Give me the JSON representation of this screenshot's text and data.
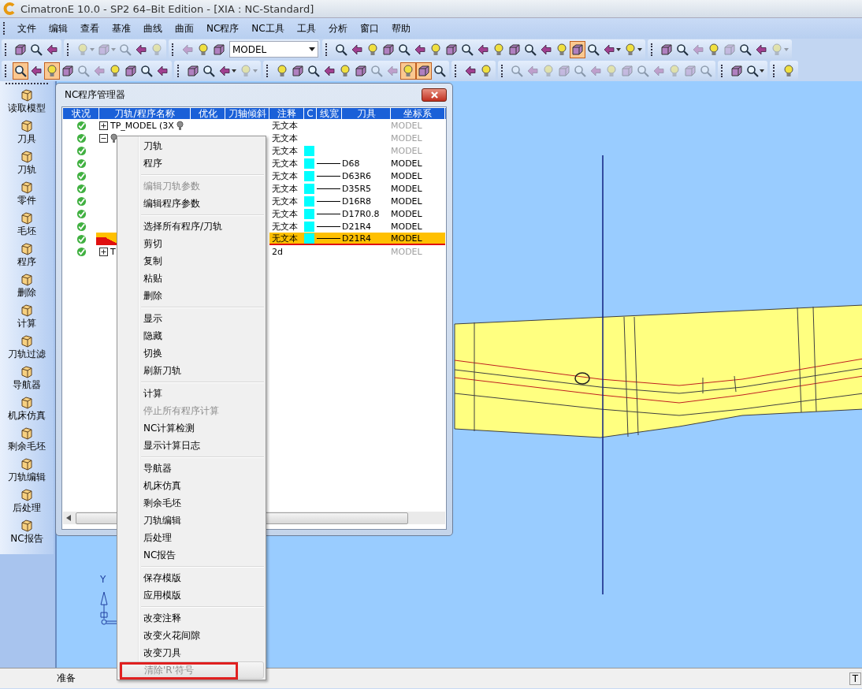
{
  "window": {
    "title": "CimatronE 10.0 - SP2 64–Bit Edition - [XIA : NC-Standard]"
  },
  "menu_bar": [
    "文件",
    "编辑",
    "查看",
    "基准",
    "曲线",
    "曲面",
    "NC程序",
    "NC工具",
    "工具",
    "分析",
    "窗口",
    "帮助"
  ],
  "toolbars": [
    {
      "groups": [
        {
          "buttons": [
            {
              "pressed": false,
              "disabled": false,
              "dropdown": false
            },
            {
              "pressed": false,
              "disabled": false,
              "dropdown": false
            },
            {
              "pressed": false,
              "disabled": false,
              "dropdown": false
            }
          ]
        },
        {
          "buttons": [
            {
              "pressed": false,
              "disabled": true,
              "dropdown": true
            },
            {
              "pressed": false,
              "disabled": true,
              "dropdown": true
            },
            {
              "pressed": false,
              "disabled": true,
              "dropdown": false
            },
            {
              "pressed": false,
              "disabled": false,
              "dropdown": false
            },
            {
              "pressed": false,
              "disabled": true,
              "dropdown": false
            }
          ]
        },
        {
          "buttons": [
            {
              "pressed": false,
              "disabled": true,
              "dropdown": false
            },
            {
              "pressed": false,
              "disabled": false,
              "dropdown": false
            },
            {
              "pressed": false,
              "disabled": false,
              "dropdown": false
            }
          ],
          "combo": {
            "value": "MODEL"
          }
        },
        {
          "buttons": [
            {
              "pressed": false,
              "disabled": false,
              "dropdown": false
            },
            {
              "pressed": false,
              "disabled": false,
              "dropdown": false
            },
            {
              "pressed": false,
              "disabled": false,
              "dropdown": false
            },
            {
              "pressed": false,
              "disabled": false,
              "dropdown": false
            },
            {
              "pressed": false,
              "disabled": false,
              "dropdown": false
            },
            {
              "pressed": false,
              "disabled": false,
              "dropdown": false
            },
            {
              "pressed": false,
              "disabled": false,
              "dropdown": false
            },
            {
              "pressed": false,
              "disabled": false,
              "dropdown": false
            },
            {
              "pressed": false,
              "disabled": false,
              "dropdown": false
            },
            {
              "pressed": false,
              "disabled": false,
              "dropdown": false
            },
            {
              "pressed": false,
              "disabled": false,
              "dropdown": false
            },
            {
              "pressed": false,
              "disabled": false,
              "dropdown": false
            },
            {
              "pressed": false,
              "disabled": false,
              "dropdown": false
            },
            {
              "pressed": false,
              "disabled": false,
              "dropdown": false
            },
            {
              "pressed": false,
              "disabled": false,
              "dropdown": false
            },
            {
              "pressed": true,
              "disabled": false,
              "dropdown": false
            },
            {
              "pressed": false,
              "disabled": false,
              "dropdown": false
            },
            {
              "pressed": false,
              "disabled": false,
              "dropdown": true
            },
            {
              "pressed": false,
              "disabled": false,
              "dropdown": true
            }
          ]
        },
        {
          "buttons": [
            {
              "pressed": false,
              "disabled": false,
              "dropdown": false
            },
            {
              "pressed": false,
              "disabled": false,
              "dropdown": false
            },
            {
              "pressed": false,
              "disabled": true,
              "dropdown": false
            },
            {
              "pressed": false,
              "disabled": false,
              "dropdown": false
            },
            {
              "pressed": false,
              "disabled": true,
              "dropdown": false
            },
            {
              "pressed": false,
              "disabled": false,
              "dropdown": false
            },
            {
              "pressed": false,
              "disabled": false,
              "dropdown": false
            },
            {
              "pressed": false,
              "disabled": true,
              "dropdown": true
            }
          ]
        }
      ]
    },
    {
      "groups": [
        {
          "buttons": [
            {
              "pressed": true,
              "disabled": false,
              "dropdown": false
            },
            {
              "pressed": false,
              "disabled": false,
              "dropdown": false
            },
            {
              "pressed": true,
              "disabled": false,
              "dropdown": false
            },
            {
              "pressed": false,
              "disabled": false,
              "dropdown": false
            },
            {
              "pressed": false,
              "disabled": true,
              "dropdown": false
            },
            {
              "pressed": false,
              "disabled": true,
              "dropdown": false
            },
            {
              "pressed": false,
              "disabled": false,
              "dropdown": false
            },
            {
              "pressed": false,
              "disabled": false,
              "dropdown": false
            },
            {
              "pressed": false,
              "disabled": false,
              "dropdown": false
            },
            {
              "pressed": false,
              "disabled": false,
              "dropdown": false
            }
          ]
        },
        {
          "buttons": [
            {
              "pressed": false,
              "disabled": false,
              "dropdown": false
            },
            {
              "pressed": false,
              "disabled": false,
              "dropdown": false
            },
            {
              "pressed": false,
              "disabled": false,
              "dropdown": true
            },
            {
              "pressed": false,
              "disabled": true,
              "dropdown": true
            }
          ]
        },
        {
          "buttons": [
            {
              "pressed": false,
              "disabled": false,
              "dropdown": false
            },
            {
              "pressed": false,
              "disabled": false,
              "dropdown": false
            },
            {
              "pressed": false,
              "disabled": false,
              "dropdown": false
            },
            {
              "pressed": false,
              "disabled": false,
              "dropdown": false
            },
            {
              "pressed": false,
              "disabled": false,
              "dropdown": false
            },
            {
              "pressed": false,
              "disabled": false,
              "dropdown": false
            },
            {
              "pressed": false,
              "disabled": true,
              "dropdown": false
            },
            {
              "pressed": false,
              "disabled": true,
              "dropdown": false
            },
            {
              "pressed": true,
              "disabled": false,
              "dropdown": false
            },
            {
              "pressed": true,
              "disabled": false,
              "dropdown": false
            },
            {
              "pressed": false,
              "disabled": false,
              "dropdown": false
            }
          ]
        },
        {
          "buttons": [
            {
              "pressed": false,
              "disabled": false,
              "dropdown": false
            },
            {
              "pressed": false,
              "disabled": false,
              "dropdown": false
            }
          ]
        },
        {
          "buttons": [
            {
              "pressed": false,
              "disabled": true,
              "dropdown": false
            },
            {
              "pressed": false,
              "disabled": true,
              "dropdown": false
            },
            {
              "pressed": false,
              "disabled": true,
              "dropdown": false
            },
            {
              "pressed": false,
              "disabled": true,
              "dropdown": false
            },
            {
              "pressed": false,
              "disabled": true,
              "dropdown": false
            },
            {
              "pressed": false,
              "disabled": true,
              "dropdown": false
            },
            {
              "pressed": false,
              "disabled": true,
              "dropdown": false
            },
            {
              "pressed": false,
              "disabled": true,
              "dropdown": false
            },
            {
              "pressed": false,
              "disabled": true,
              "dropdown": false
            },
            {
              "pressed": false,
              "disabled": true,
              "dropdown": false
            },
            {
              "pressed": false,
              "disabled": true,
              "dropdown": false
            },
            {
              "pressed": false,
              "disabled": true,
              "dropdown": false
            },
            {
              "pressed": false,
              "disabled": true,
              "dropdown": false
            }
          ]
        },
        {
          "buttons": [
            {
              "pressed": false,
              "disabled": false,
              "dropdown": false
            },
            {
              "pressed": false,
              "disabled": false,
              "dropdown": true
            }
          ]
        },
        {
          "buttons": [
            {
              "pressed": false,
              "disabled": false,
              "dropdown": false
            }
          ]
        }
      ]
    }
  ],
  "sidebar": {
    "items": [
      "读取模型",
      "刀具",
      "刀轨",
      "零件",
      "毛坯",
      "程序",
      "删除",
      "计算",
      "刀轨过滤",
      "导航器",
      "机床仿真",
      "剩余毛坯",
      "刀轨编辑",
      "后处理",
      "NC报告"
    ]
  },
  "nc_manager": {
    "title": "NC程序管理器",
    "columns": [
      "状况",
      "刀轨/程序名称",
      "优化",
      "刀轴倾斜",
      "注释",
      "C",
      "线宽",
      "刀具",
      "坐标系"
    ],
    "rows": [
      {
        "expandable": true,
        "expanded": false,
        "name": "TP_MODEL (3X",
        "bulb": true,
        "comment": "无文本",
        "swatch": false,
        "coord": "MODEL",
        "dimmed": true,
        "selected": false
      },
      {
        "expandable": true,
        "expanded": true,
        "bulb": true,
        "comment": "无文本",
        "swatch": false,
        "coord": "MODEL",
        "dimmed": true,
        "selected": false
      },
      {
        "expandable": false,
        "bulb": false,
        "comment": "无文本",
        "swatch": true,
        "coord": "MODEL",
        "dimmed": true,
        "selected": false
      },
      {
        "expandable": false,
        "bulb": false,
        "comment": "无文本",
        "swatch": true,
        "tool": "D68",
        "coord": "MODEL",
        "dimmed": false,
        "selected": false
      },
      {
        "expandable": false,
        "bulb": false,
        "comment": "无文本",
        "swatch": true,
        "tool": "D63R6",
        "coord": "MODEL",
        "dimmed": false,
        "selected": false
      },
      {
        "expandable": false,
        "bulb": false,
        "comment": "无文本",
        "swatch": true,
        "tool": "D35R5",
        "coord": "MODEL",
        "dimmed": false,
        "selected": false
      },
      {
        "expandable": false,
        "bulb": false,
        "comment": "无文本",
        "swatch": true,
        "tool": "D16R8",
        "coord": "MODEL",
        "dimmed": false,
        "selected": false
      },
      {
        "expandable": false,
        "bulb": false,
        "comment": "无文本",
        "swatch": true,
        "tool": "D17R0.8",
        "coord": "MODEL",
        "dimmed": false,
        "selected": false
      },
      {
        "expandable": false,
        "bulb": false,
        "comment": "无文本",
        "swatch": true,
        "tool": "D21R4",
        "coord": "MODEL",
        "dimmed": false,
        "selected": false
      },
      {
        "expandable": false,
        "bulb": false,
        "comment": "无文本",
        "swatch": true,
        "tool": "D21R4",
        "coord": "MODEL",
        "dimmed": false,
        "selected": true
      },
      {
        "expandable": true,
        "expanded": false,
        "name": "T",
        "bulb": false,
        "comment": "2d",
        "swatch": false,
        "coord": "MODEL",
        "dimmed": true,
        "selected": false
      }
    ]
  },
  "context_menu": {
    "groups": [
      {
        "items": [
          {
            "label": "刀轨",
            "disabled": false,
            "highlighted": false,
            "outlined": false
          },
          {
            "label": "程序",
            "disabled": false,
            "highlighted": false,
            "outlined": false
          }
        ]
      },
      {
        "items": [
          {
            "label": "编辑刀轨参数",
            "disabled": true,
            "highlighted": false,
            "outlined": false
          },
          {
            "label": "编辑程序参数",
            "disabled": false,
            "highlighted": false,
            "outlined": false
          }
        ]
      },
      {
        "items": [
          {
            "label": "选择所有程序/刀轨",
            "disabled": false,
            "highlighted": false,
            "outlined": false
          },
          {
            "label": "剪切",
            "disabled": false,
            "highlighted": false,
            "outlined": false
          },
          {
            "label": "复制",
            "disabled": false,
            "highlighted": false,
            "outlined": false
          },
          {
            "label": "粘贴",
            "disabled": false,
            "highlighted": false,
            "outlined": false
          },
          {
            "label": "删除",
            "disabled": false,
            "highlighted": false,
            "outlined": false
          }
        ]
      },
      {
        "items": [
          {
            "label": "显示",
            "disabled": false,
            "highlighted": false,
            "outlined": false
          },
          {
            "label": "隐藏",
            "disabled": false,
            "highlighted": false,
            "outlined": false
          },
          {
            "label": "切换",
            "disabled": false,
            "highlighted": false,
            "outlined": false
          },
          {
            "label": "刷新刀轨",
            "disabled": false,
            "highlighted": false,
            "outlined": false
          }
        ]
      },
      {
        "items": [
          {
            "label": "计算",
            "disabled": false,
            "highlighted": false,
            "outlined": false
          },
          {
            "label": "停止所有程序计算",
            "disabled": true,
            "highlighted": false,
            "outlined": false
          },
          {
            "label": "NC计算检测",
            "disabled": false,
            "highlighted": false,
            "outlined": false
          },
          {
            "label": "显示计算日志",
            "disabled": false,
            "highlighted": false,
            "outlined": false
          }
        ]
      },
      {
        "items": [
          {
            "label": "导航器",
            "disabled": false,
            "highlighted": false,
            "outlined": false
          },
          {
            "label": "机床仿真",
            "disabled": false,
            "highlighted": false,
            "outlined": false
          },
          {
            "label": "剩余毛坯",
            "disabled": false,
            "highlighted": false,
            "outlined": false
          },
          {
            "label": "刀轨编辑",
            "disabled": false,
            "highlighted": false,
            "outlined": false
          },
          {
            "label": "后处理",
            "disabled": false,
            "highlighted": false,
            "outlined": false
          },
          {
            "label": "NC报告",
            "disabled": false,
            "highlighted": false,
            "outlined": false
          }
        ]
      },
      {
        "items": [
          {
            "label": "保存模版",
            "disabled": false,
            "highlighted": false,
            "outlined": false
          },
          {
            "label": "应用模版",
            "disabled": false,
            "highlighted": false,
            "outlined": false
          }
        ]
      },
      {
        "items": [
          {
            "label": "改变注释",
            "disabled": false,
            "highlighted": false,
            "outlined": false
          },
          {
            "label": "改变火花间隙",
            "disabled": false,
            "highlighted": false,
            "outlined": false
          },
          {
            "label": "改变刀具",
            "disabled": false,
            "highlighted": false,
            "outlined": false
          },
          {
            "label": "清除'R'符号",
            "disabled": true,
            "highlighted": true,
            "outlined": true
          }
        ]
      }
    ]
  },
  "viewport": {
    "axis_label": "Y"
  },
  "status_bar": {
    "text": "准备",
    "right": "T"
  }
}
